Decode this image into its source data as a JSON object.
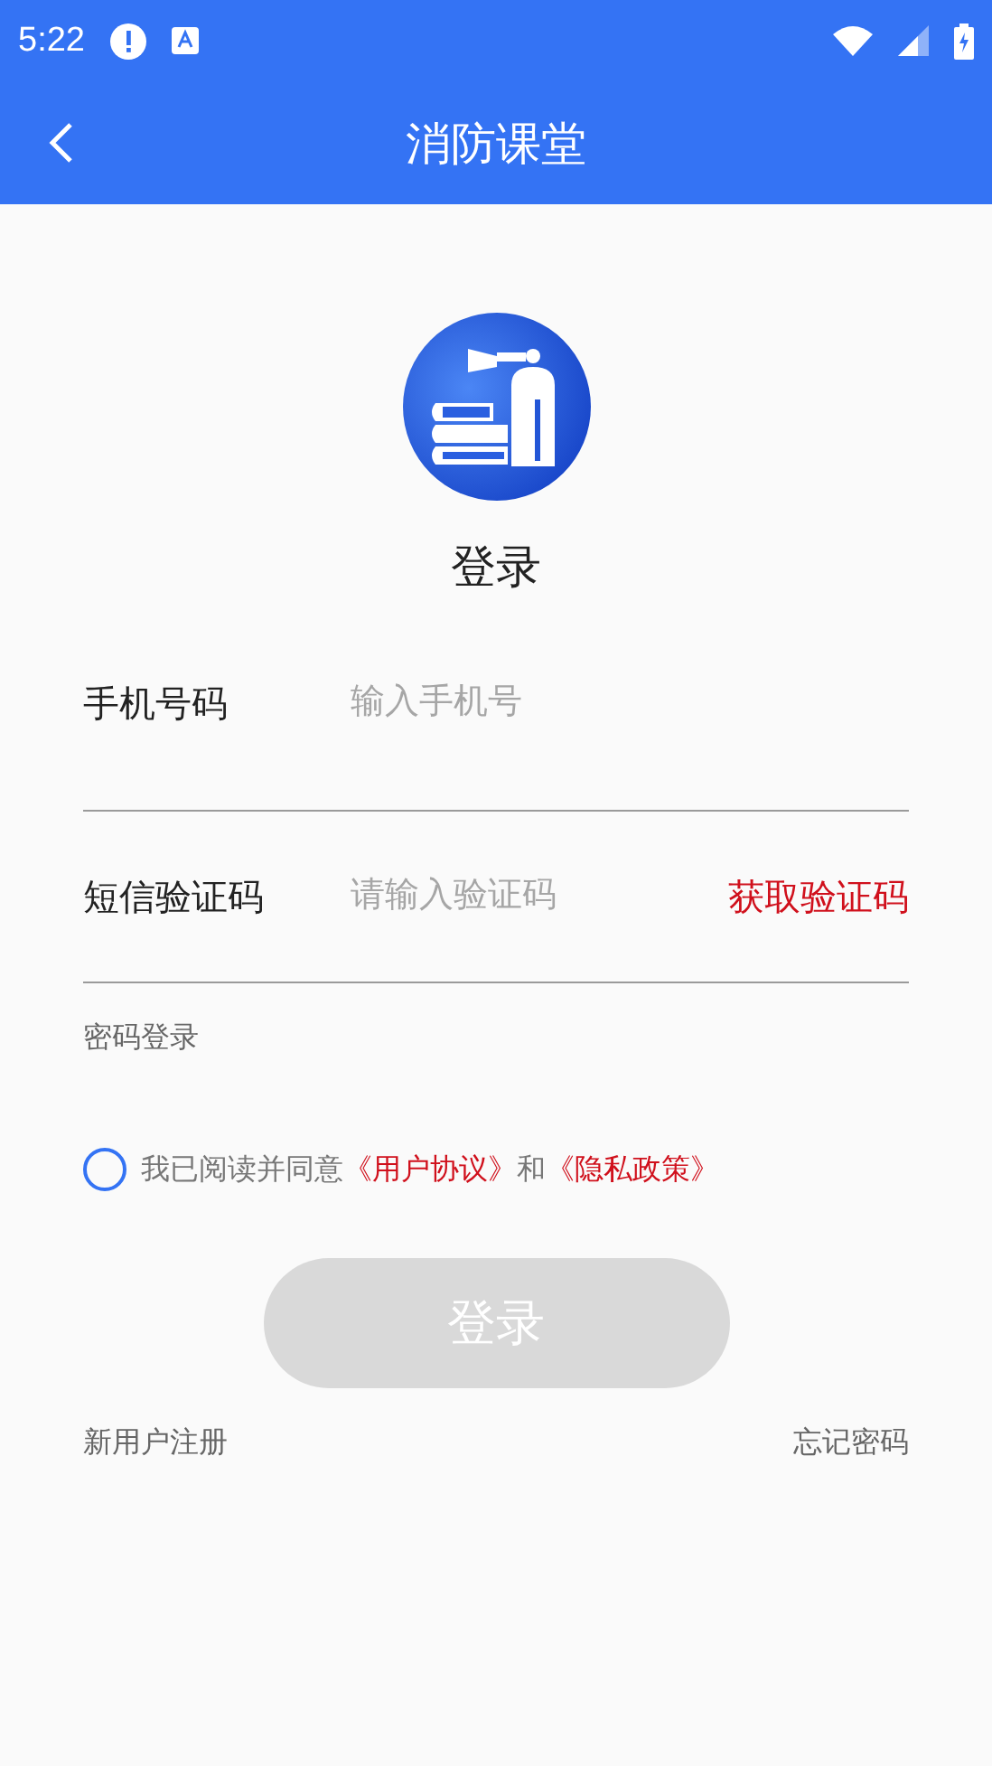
{
  "status_bar": {
    "time": "5:22"
  },
  "app_bar": {
    "title": "消防课堂"
  },
  "login_title": "登录",
  "fields": [
    {
      "label": "手机号码",
      "placeholder": "输入手机号"
    },
    {
      "label": "短信验证码",
      "placeholder": "请输入验证码",
      "action": "获取验证码"
    }
  ],
  "password_login_link": "密码登录",
  "agreement": {
    "checked": false,
    "text": "我已阅读并同意",
    "link_1": "《用户协议》",
    "joiner": "和",
    "link_2": "《隐私政策》"
  },
  "login_button": {
    "label": "登录",
    "disabled": true
  },
  "register_link": "新用户注册",
  "forgot_link": "忘记密码"
}
